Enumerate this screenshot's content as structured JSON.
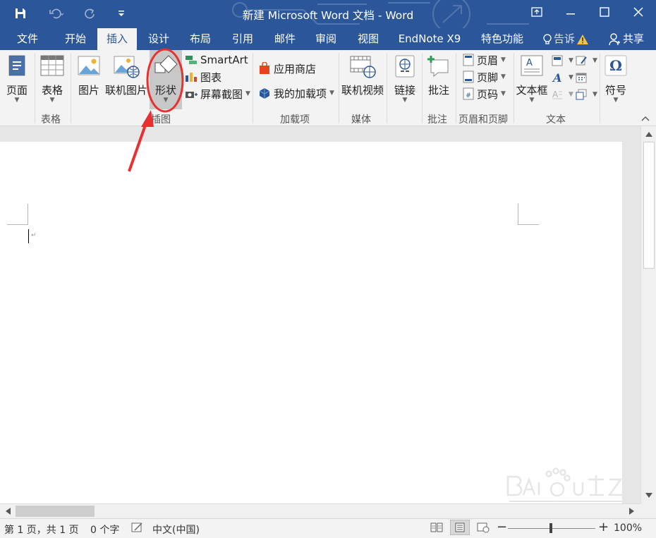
{
  "window": {
    "title": "新建 Microsoft Word 文档 - Word"
  },
  "quick_access": {
    "save_icon": "save-icon",
    "undo_icon": "undo-icon",
    "redo_icon": "redo-icon",
    "customize_icon": "customize-qat-icon"
  },
  "tabs": [
    {
      "label": "文件"
    },
    {
      "label": "开始"
    },
    {
      "label": "插入",
      "active": true
    },
    {
      "label": "设计"
    },
    {
      "label": "布局"
    },
    {
      "label": "引用"
    },
    {
      "label": "邮件"
    },
    {
      "label": "审阅"
    },
    {
      "label": "视图"
    },
    {
      "label": "EndNote X9"
    },
    {
      "label": "特色功能"
    }
  ],
  "tellme": {
    "label": "告诉"
  },
  "share": {
    "label": "共享"
  },
  "ribbon": {
    "pages": {
      "label": "页面",
      "group": ""
    },
    "table": {
      "label": "表格",
      "group": "表格"
    },
    "picture": {
      "label": "图片"
    },
    "online_picture": {
      "label": "联机图片"
    },
    "shapes": {
      "label": "形状"
    },
    "smartart": {
      "label": "SmartArt"
    },
    "chart": {
      "label": "图表"
    },
    "screenshot": {
      "label": "屏幕截图"
    },
    "illustrations_group": "插图",
    "store": {
      "label": "应用商店"
    },
    "my_addins": {
      "label": "我的加载项"
    },
    "addins_group": "加载项",
    "online_video": {
      "label": "联机视频"
    },
    "media_group": "媒体",
    "links": {
      "label": "链接"
    },
    "comment": {
      "label": "批注"
    },
    "comment_group": "批注",
    "header": {
      "label": "页眉"
    },
    "footer": {
      "label": "页脚"
    },
    "page_number": {
      "label": "页码"
    },
    "header_footer_group": "页眉和页脚",
    "textbox": {
      "label": "文本框"
    },
    "text_group": "文本",
    "symbol": {
      "label": "符号"
    }
  },
  "status": {
    "page": "第 1 页，共 1 页",
    "words": "0 个字",
    "language": "中文(中国)",
    "zoom": "100%"
  },
  "colors": {
    "brand": "#2b579a",
    "annotation": "#e8302f"
  }
}
